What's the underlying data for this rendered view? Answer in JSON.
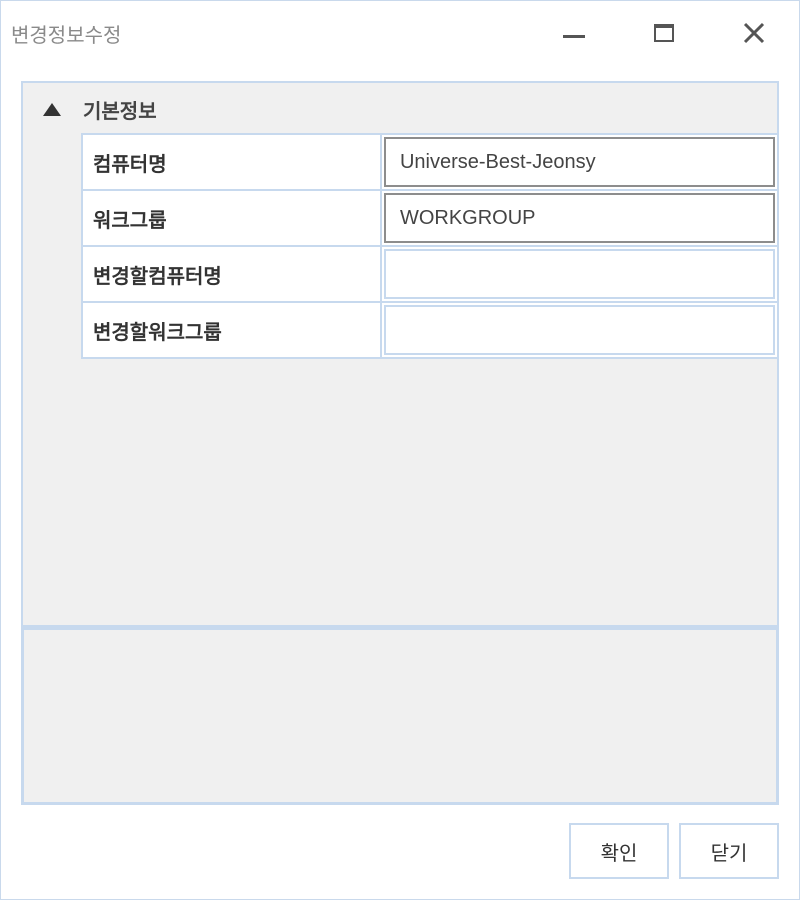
{
  "window": {
    "title": "변경정보수정",
    "controls": {
      "minimize_icon": "minimize-icon",
      "maximize_icon": "maximize-icon",
      "close_icon": "close-icon"
    }
  },
  "section": {
    "title": "기본정보",
    "collapse_icon": "triangle-up-icon",
    "rows": [
      {
        "label": "컴퓨터명",
        "value": "Universe-Best-Jeonsy"
      },
      {
        "label": "워크그룹",
        "value": "WORKGROUP"
      },
      {
        "label": "변경할컴퓨터명",
        "value": ""
      },
      {
        "label": "변경할워크그룹",
        "value": ""
      }
    ]
  },
  "buttons": {
    "ok_label": "확인",
    "close_label": "닫기"
  },
  "colors": {
    "border": "#c7d9ee",
    "panel_bg": "#f0f0f0",
    "filled_border": "#8d8d8d"
  }
}
